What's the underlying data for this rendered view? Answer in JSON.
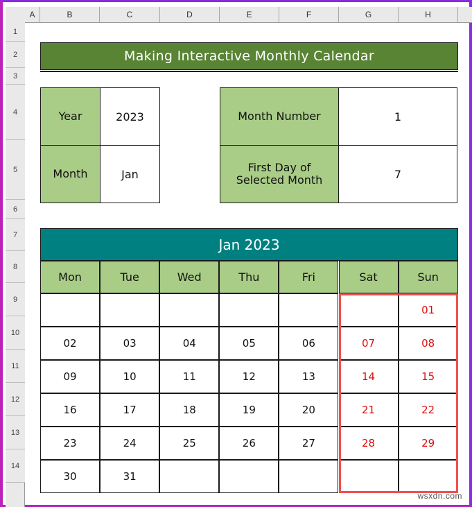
{
  "spreadsheet": {
    "column_headers": [
      "A",
      "B",
      "C",
      "D",
      "E",
      "F",
      "G",
      "H"
    ],
    "row_headers": [
      "1",
      "2",
      "3",
      "4",
      "5",
      "6",
      "7",
      "8",
      "9",
      "10",
      "11",
      "12",
      "13",
      "14"
    ],
    "watermark": "wsxdn.com"
  },
  "title_banner": {
    "text": "Making Interactive Monthly Calendar",
    "fill": "#588434",
    "text_color": "#ffffff"
  },
  "input_table_left": {
    "rows": [
      {
        "label": "Year",
        "value": "2023"
      },
      {
        "label": "Month",
        "value": "Jan"
      }
    ]
  },
  "input_table_right": {
    "rows": [
      {
        "label": "Month Number",
        "value": "1"
      },
      {
        "label": "First Day of Selected Month",
        "value": "7"
      }
    ]
  },
  "calendar": {
    "heading": "Jan 2023",
    "heading_fill": "#008080",
    "day_header_fill": "#a9cc87",
    "weekend_color": "#e00b0b",
    "highlight_border_color": "#f05050",
    "day_names": [
      "Mon",
      "Tue",
      "Wed",
      "Thu",
      "Fri",
      "Sat",
      "Sun"
    ],
    "weeks": [
      [
        "",
        "",
        "",
        "",
        "",
        "",
        "01"
      ],
      [
        "02",
        "03",
        "04",
        "05",
        "06",
        "07",
        "08"
      ],
      [
        "09",
        "10",
        "11",
        "12",
        "13",
        "14",
        "15"
      ],
      [
        "16",
        "17",
        "18",
        "19",
        "20",
        "21",
        "22"
      ],
      [
        "23",
        "24",
        "25",
        "26",
        "27",
        "28",
        "29"
      ],
      [
        "30",
        "31",
        "",
        "",
        "",
        "",
        ""
      ]
    ]
  }
}
